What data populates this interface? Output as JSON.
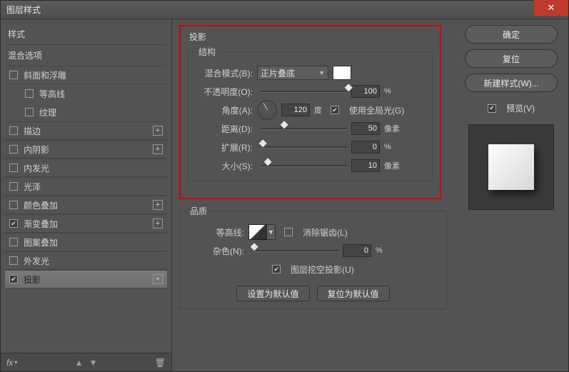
{
  "window": {
    "title": "图层样式"
  },
  "left": {
    "header_styles": "样式",
    "header_blend": "混合选项",
    "items": [
      {
        "label": "斜面和浮雕",
        "checked": false,
        "hasPlus": false,
        "sub": [
          {
            "label": "等高线",
            "checked": false
          },
          {
            "label": "纹理",
            "checked": false
          }
        ]
      },
      {
        "label": "描边",
        "checked": false,
        "hasPlus": true
      },
      {
        "label": "内阴影",
        "checked": false,
        "hasPlus": true
      },
      {
        "label": "内发光",
        "checked": false,
        "hasPlus": false
      },
      {
        "label": "光泽",
        "checked": false,
        "hasPlus": false
      },
      {
        "label": "颜色叠加",
        "checked": false,
        "hasPlus": true
      },
      {
        "label": "渐变叠加",
        "checked": true,
        "hasPlus": true
      },
      {
        "label": "图案叠加",
        "checked": false,
        "hasPlus": false
      },
      {
        "label": "外发光",
        "checked": false,
        "hasPlus": false
      },
      {
        "label": "投影",
        "checked": true,
        "hasPlus": true,
        "selected": true
      }
    ],
    "footer_fx": "fx"
  },
  "main": {
    "title": "投影",
    "structure_legend": "结构",
    "blend_mode_label": "混合模式(B):",
    "blend_mode_value": "正片叠底",
    "opacity_label": "不透明度(O):",
    "opacity_value": "100",
    "opacity_unit": "%",
    "angle_label": "角度(A):",
    "angle_value": "120",
    "angle_unit": "度",
    "use_global_light_label": "使用全局光(G)",
    "use_global_light_checked": true,
    "distance_label": "距离(D):",
    "distance_value": "50",
    "distance_unit": "像素",
    "spread_label": "扩展(R):",
    "spread_value": "0",
    "spread_unit": "%",
    "size_label": "大小(S):",
    "size_value": "10",
    "size_unit": "像素",
    "quality_legend": "品质",
    "contour_label": "等高线:",
    "antialias_label": "消除锯齿(L)",
    "antialias_checked": false,
    "noise_label": "杂色(N):",
    "noise_value": "0",
    "noise_unit": "%",
    "knockout_label": "图层挖空投影(U)",
    "knockout_checked": true,
    "btn_default_set": "设置为默认值",
    "btn_default_reset": "复位为默认值"
  },
  "right": {
    "ok": "确定",
    "cancel": "复位",
    "new_style": "新建样式(W)...",
    "preview_label": "预览(V)",
    "preview_checked": true
  }
}
